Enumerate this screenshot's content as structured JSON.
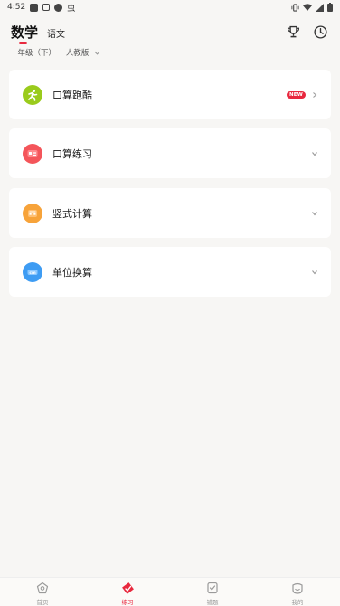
{
  "status_bar": {
    "time": "4:52",
    "notif_glyph": "虫"
  },
  "header": {
    "active_tab": "数学",
    "other_tab": "语文"
  },
  "grade": {
    "grade_label": "一年级（下）",
    "edition_label": "人教版"
  },
  "cards": [
    {
      "title": "口算跑酷",
      "badge": "NEW",
      "icon": "runner-icon",
      "color": "#9acb1c"
    },
    {
      "title": "口算练习",
      "icon": "calculator-icon",
      "color": "#f4555a"
    },
    {
      "title": "竖式计算",
      "icon": "vertical-calc-icon",
      "color": "#f7a33a"
    },
    {
      "title": "单位换算",
      "icon": "cm-ruler-icon",
      "color": "#3e9cf3"
    }
  ],
  "nav": {
    "items": [
      {
        "label": "首页",
        "icon": "home-icon"
      },
      {
        "label": "练习",
        "icon": "practice-icon"
      },
      {
        "label": "错题",
        "icon": "mistakes-icon"
      },
      {
        "label": "我的",
        "icon": "profile-icon"
      }
    ],
    "active_index": 1
  },
  "colors": {
    "accent": "#e8283e",
    "background": "#f7f6f4"
  }
}
